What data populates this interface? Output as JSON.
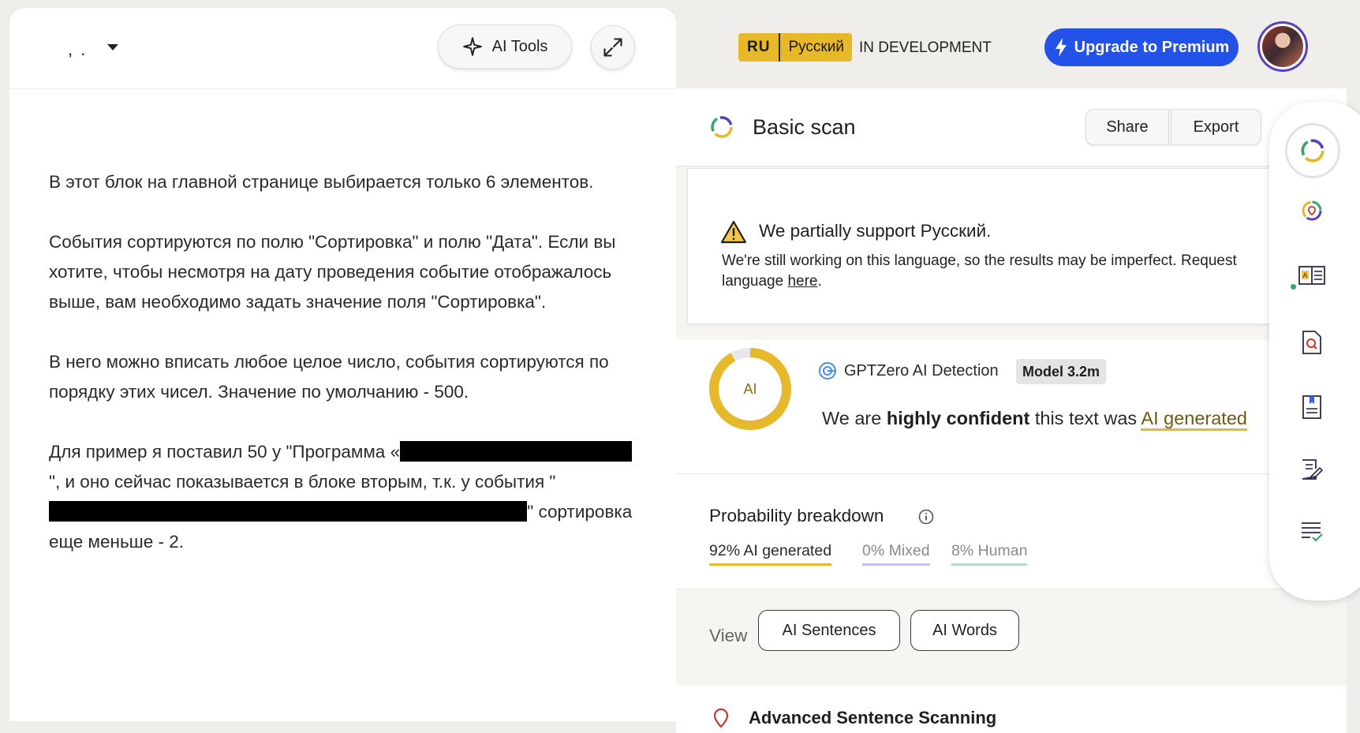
{
  "editor": {
    "doc_title": ", .",
    "ai_tools_label": "AI Tools",
    "paragraphs": {
      "p1": "В этот блок на главной странице выбирается только 6 элементов.",
      "p2": "События сортируются по полю \"Сортировка\" и полю \"Дата\". Если вы хотите, чтобы несмотря на дату проведения событие отображалось выше, вам необходимо задать значение поля \"Сортировка\".",
      "p3": "В него можно вписать любое целое число, события сортируются по порядку этих чисел. Значение по умолчанию - 500.",
      "p4a": "Для пример я поставил 50 у \"Программа «",
      "p4b": "\", и оно сейчас показывается в блоке вторым, т.к. у события \"",
      "p4c": "\" сортировка еще меньше - 2."
    }
  },
  "topbar": {
    "lang_code": "RU",
    "lang_name": "Русский",
    "status": "IN DEVELOPMENT",
    "upgrade_label": "Upgrade to Premium"
  },
  "scan": {
    "title": "Basic scan",
    "share_label": "Share",
    "export_label": "Export"
  },
  "warning": {
    "title": "We partially support Русский.",
    "text": "We're still working on this language, so the results may be imperfect. Request",
    "text2_prefix": "language ",
    "link": "here",
    "text2_suffix": "."
  },
  "detection": {
    "ring_label": "AI",
    "ai_fraction": 0.92,
    "source": "GPTZero AI Detection",
    "model": "Model 3.2m",
    "conf_prefix": "We are ",
    "conf_strong": "highly confident",
    "conf_mid": " this text was ",
    "conf_result": "AI generated"
  },
  "probability": {
    "title": "Probability breakdown",
    "ai": "92% AI generated",
    "mixed": "0% Mixed",
    "human": "8% Human"
  },
  "view": {
    "label": "View",
    "btn_sentences": "AI Sentences",
    "btn_words": "AI Words"
  },
  "advanced": {
    "label": "Advanced Sentence Scanning"
  },
  "colors": {
    "accent_blue": "#2352e8",
    "ai_yellow": "#e6b92a",
    "mixed_purple": "#c8c0ea",
    "human_green": "#b5ddc6"
  }
}
